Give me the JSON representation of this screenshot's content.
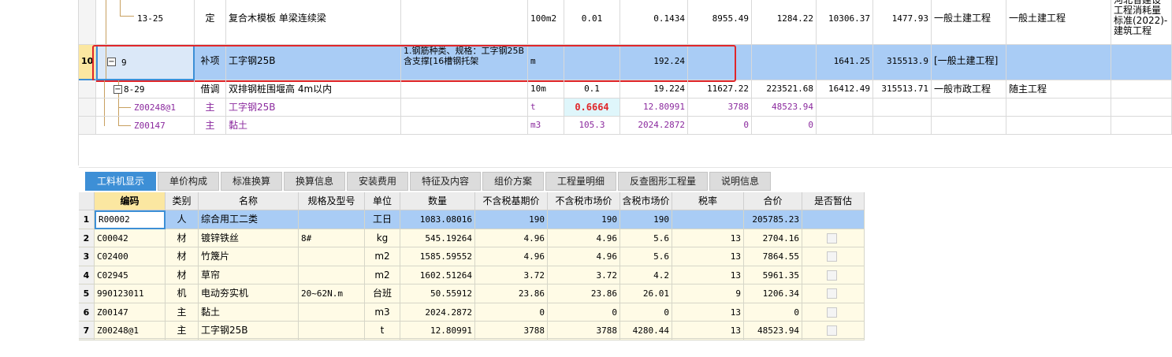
{
  "top_rows": [
    {
      "code": "13-25",
      "type": "定",
      "name": "复合木模板 单梁连续梁",
      "feature": "",
      "unit": "100m2",
      "qty": "0.01",
      "amount": "0.1434",
      "price": "8955.49",
      "total": "1284.22",
      "c1": "10306.37",
      "c2": "1477.93",
      "prof": "一般土建工程",
      "prof2": "一般土建工程",
      "std": "河北省建设工程消耗量标准(2022)-建筑工程"
    },
    {
      "rownum": "10",
      "code": "9",
      "type": "补项",
      "name": "工字钢25B",
      "feature": "1.钢筋种类、规格：工字钢25B\n含支撑[16槽钢托架",
      "unit": "m",
      "qty": "",
      "amount": "192.24",
      "price": "",
      "total": "",
      "c1": "1641.25",
      "c2": "315513.9",
      "prof": "[一般土建工程]",
      "prof2": "",
      "std": ""
    },
    {
      "code": "8-29",
      "type": "借调",
      "name": "双排钢桩围堰高 4m以内",
      "feature": "",
      "unit": "10m",
      "qty": "0.1",
      "amount": "19.224",
      "price": "11627.22",
      "total": "223521.68",
      "c1": "16412.49",
      "c2": "315513.71",
      "prof": "一般市政工程",
      "prof2": "随主工程",
      "std": ""
    },
    {
      "code": "Z00248@1",
      "type": "主",
      "name": "工字钢25B",
      "feature": "",
      "unit": "t",
      "qty": "0.6664",
      "amount": "12.80991",
      "price": "3788",
      "total": "48523.94",
      "c1": "",
      "c2": "",
      "prof": "",
      "prof2": "",
      "std": ""
    },
    {
      "code": "Z00147",
      "type": "主",
      "name": "黏土",
      "feature": "",
      "unit": "m3",
      "qty": "105.3",
      "amount": "2024.2872",
      "price": "0",
      "total": "0",
      "c1": "",
      "c2": "",
      "prof": "",
      "prof2": "",
      "std": ""
    }
  ],
  "tabs": [
    "工料机显示",
    "单价构成",
    "标准换算",
    "换算信息",
    "安装费用",
    "特征及内容",
    "组价方案",
    "工程量明细",
    "反查图形工程量",
    "说明信息"
  ],
  "headers": [
    "编码",
    "类别",
    "名称",
    "规格及型号",
    "单位",
    "数量",
    "不含税基期价",
    "不含税市场价",
    "含税市场价",
    "税率",
    "合价",
    "是否暂估"
  ],
  "rows": [
    {
      "idx": "1",
      "code": "R00002",
      "cat": "人",
      "name": "综合用工二类",
      "spec": "",
      "unit": "工日",
      "qty": "1083.08016",
      "base": "190",
      "market": "190",
      "tax_market": "190",
      "rate": "",
      "total": "205785.23"
    },
    {
      "idx": "2",
      "code": "C00042",
      "cat": "材",
      "name": "镀锌铁丝",
      "spec": "8#",
      "unit": "kg",
      "qty": "545.19264",
      "base": "4.96",
      "market": "4.96",
      "tax_market": "5.6",
      "rate": "13",
      "total": "2704.16"
    },
    {
      "idx": "3",
      "code": "C02400",
      "cat": "材",
      "name": "竹篾片",
      "spec": "",
      "unit": "m2",
      "qty": "1585.59552",
      "base": "4.96",
      "market": "4.96",
      "tax_market": "5.6",
      "rate": "13",
      "total": "7864.55"
    },
    {
      "idx": "4",
      "code": "C02945",
      "cat": "材",
      "name": "草帘",
      "spec": "",
      "unit": "m2",
      "qty": "1602.51264",
      "base": "3.72",
      "market": "3.72",
      "tax_market": "4.2",
      "rate": "13",
      "total": "5961.35"
    },
    {
      "idx": "5",
      "code": "990123011",
      "cat": "机",
      "name": "电动夯实机",
      "spec": "20~62N.m",
      "unit": "台班",
      "qty": "50.55912",
      "base": "23.86",
      "market": "23.86",
      "tax_market": "26.01",
      "rate": "9",
      "total": "1206.34"
    },
    {
      "idx": "6",
      "code": "Z00147",
      "cat": "主",
      "name": "黏土",
      "spec": "",
      "unit": "m3",
      "qty": "2024.2872",
      "base": "0",
      "market": "0",
      "tax_market": "0",
      "rate": "13",
      "total": "0"
    },
    {
      "idx": "7",
      "code": "Z00248@1",
      "cat": "主",
      "name": "工字钢25B",
      "spec": "",
      "unit": "t",
      "qty": "12.80991",
      "base": "3788",
      "market": "3788",
      "tax_market": "4280.44",
      "rate": "13",
      "total": "48523.94"
    }
  ]
}
